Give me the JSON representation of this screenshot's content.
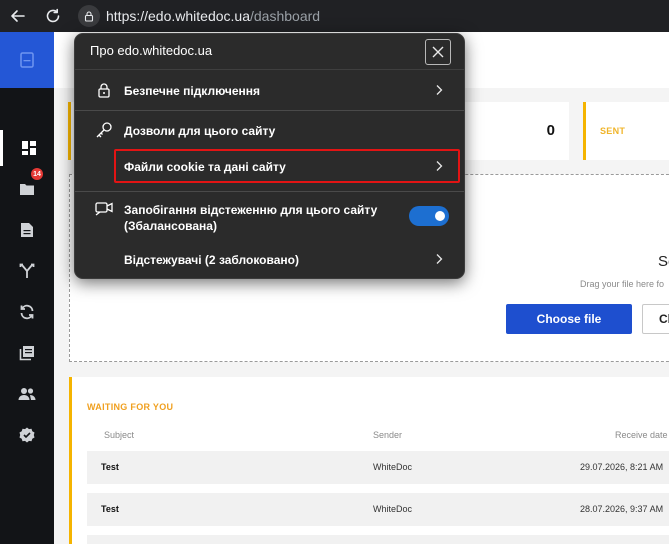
{
  "browser": {
    "url_host": "https://edo.whitedoc.ua",
    "url_path": "/dashboard"
  },
  "sidebar": {
    "badge_count": "14",
    "items": [
      {
        "icon": "dashboard-icon",
        "active": true
      },
      {
        "icon": "folder-icon",
        "active": false
      },
      {
        "icon": "document-icon",
        "active": false
      },
      {
        "icon": "route-icon",
        "active": false
      },
      {
        "icon": "sync-icon",
        "active": false
      },
      {
        "icon": "library-icon",
        "active": false
      },
      {
        "icon": "contacts-icon",
        "active": false
      },
      {
        "icon": "verified-icon",
        "active": false
      }
    ]
  },
  "stats": [
    {
      "value": "0",
      "label": ""
    },
    {
      "value": "",
      "label": "SENT"
    }
  ],
  "upload": {
    "title_fragment": "Se",
    "hint": "Drag your file here fo",
    "choose_label": "Choose file",
    "secondary_label": "Ch"
  },
  "waiting": {
    "title": "WAITING FOR YOU",
    "columns": [
      "Subject",
      "Sender",
      "Receive date"
    ],
    "rows": [
      {
        "subject": "Test",
        "sender": "WhiteDoc",
        "date": "29.07.2026, 8:21 AM"
      },
      {
        "subject": "Test",
        "sender": "WhiteDoc",
        "date": "28.07.2026, 9:37 AM"
      }
    ]
  },
  "popup": {
    "title": "Про edo.whitedoc.ua",
    "items": {
      "secure": "Безпечне підключення",
      "permissions": "Дозволи для цього сайту",
      "cookies": "Файли cookie та дані сайту",
      "tracking_prevention_line1": "Запобігання відстеженню для цього сайту",
      "tracking_prevention_line2": "(Збалансована)",
      "trackers": "Відстежувачі (2 заблоковано)"
    },
    "tracking_prevention_enabled": true
  },
  "colors": {
    "accent_blue": "#1e4fcf",
    "sidebar_bg": "#121417",
    "card_accent": "#f5b400",
    "highlight_red": "#e21414",
    "toggle_blue": "#1d6fd1"
  }
}
